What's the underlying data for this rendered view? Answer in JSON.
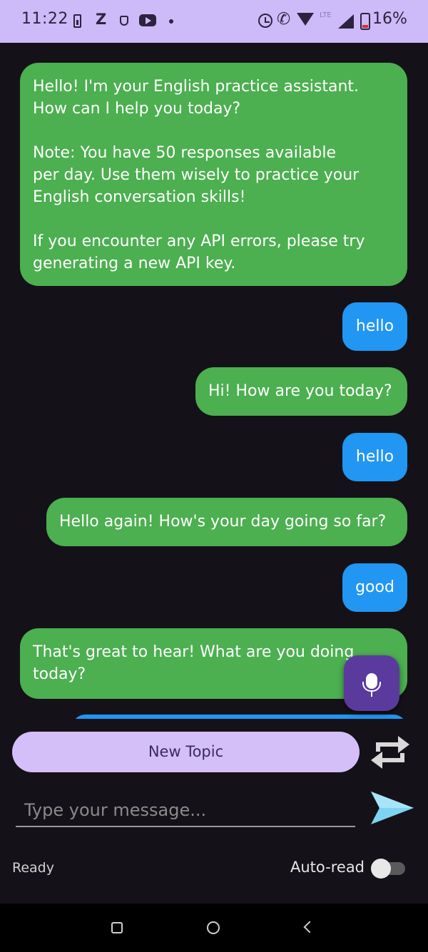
{
  "status_bar": {
    "time": "11:22",
    "z_label": "Z",
    "network_label": "LTE",
    "battery_percent": "16%"
  },
  "chat": {
    "messages": [
      {
        "role": "bot",
        "text": "Hello! I'm your English practice assistant.\nHow can I help you today?\n\nNote: You have 50 responses available\nper day. Use them wisely to practice your\nEnglish conversation skills!\n\nIf you encounter any API errors, please try\ngenerating a new API key."
      },
      {
        "role": "user",
        "text": "hello"
      },
      {
        "role": "bot",
        "text": "Hi! How are you today?"
      },
      {
        "role": "user",
        "text": "hello"
      },
      {
        "role": "bot",
        "text": "Hello again! How's your day going so far?"
      },
      {
        "role": "user",
        "text": "good"
      },
      {
        "role": "bot",
        "text": "That's great to hear! What are you doing\ntoday?"
      }
    ]
  },
  "controls": {
    "new_topic_label": "New Topic",
    "message_placeholder": "Type your message...",
    "status_text": "Ready",
    "auto_read_label": "Auto-read",
    "auto_read_enabled": false
  },
  "colors": {
    "bot_bubble": "#4caf50",
    "user_bubble": "#2196f3",
    "accent": "#cdbaf8",
    "background": "#141218"
  },
  "icons": {
    "mic_fab": "mic-icon",
    "repeat": "repeat-icon",
    "send": "send-icon",
    "nav_recents": "square-icon",
    "nav_home": "circle-icon",
    "nav_back": "back-chevron-icon"
  }
}
